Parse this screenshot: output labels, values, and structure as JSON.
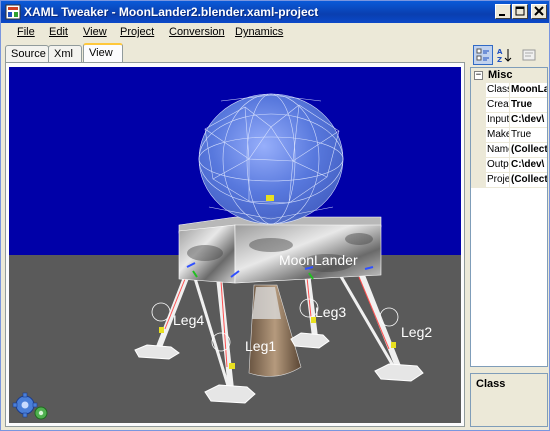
{
  "window": {
    "title": "XAML Tweaker - MoonLander2.blender.xaml-project"
  },
  "menu": [
    {
      "label": "File"
    },
    {
      "label": "Edit"
    },
    {
      "label": "View"
    },
    {
      "label": "Project"
    },
    {
      "label": "Conversion"
    },
    {
      "label": "Dynamics"
    }
  ],
  "tabs": [
    {
      "label": "Source"
    },
    {
      "label": "Xml"
    },
    {
      "label": "View",
      "active": true
    }
  ],
  "viewport": {
    "sky_color": "#0000a8",
    "ground_color": "#5a5a5a",
    "labels": {
      "body": "MoonLander",
      "leg1": "Leg1",
      "leg2": "Leg2",
      "leg3": "Leg3",
      "leg4": "Leg4"
    }
  },
  "propgrid": {
    "category": "Misc",
    "rows": [
      {
        "name": "Class",
        "value": "MoonLander",
        "bold": true
      },
      {
        "name": "CreateGeometry",
        "value": "True",
        "bold": true
      },
      {
        "name": "InputFile",
        "value": "C:\\dev\\",
        "bold": true
      },
      {
        "name": "MakeResources",
        "value": "True",
        "bold": false
      },
      {
        "name": "Namespaces",
        "value": "(Collection)",
        "bold": true
      },
      {
        "name": "OutputFile",
        "value": "C:\\dev\\",
        "bold": true
      },
      {
        "name": "Projects",
        "value": "(Collection)",
        "bold": true
      }
    ]
  },
  "description": {
    "title": "Class"
  }
}
